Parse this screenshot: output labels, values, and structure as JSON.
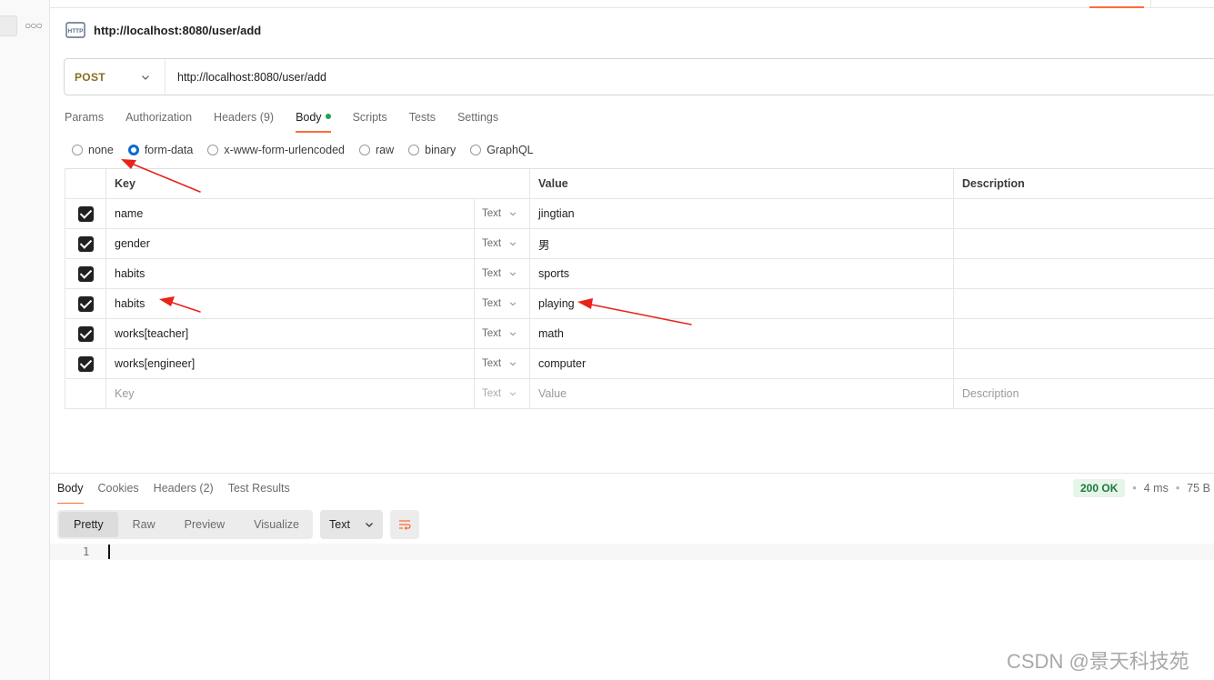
{
  "request": {
    "title": "http://localhost:8080/user/add",
    "method": "POST",
    "url": "http://localhost:8080/user/add"
  },
  "tabs": [
    {
      "label": "Params",
      "count": ""
    },
    {
      "label": "Authorization",
      "count": ""
    },
    {
      "label": "Headers",
      "count": "(9)"
    },
    {
      "label": "Body",
      "count": ""
    },
    {
      "label": "Scripts",
      "count": ""
    },
    {
      "label": "Tests",
      "count": ""
    },
    {
      "label": "Settings",
      "count": ""
    }
  ],
  "body_modes": [
    "none",
    "form-data",
    "x-www-form-urlencoded",
    "raw",
    "binary",
    "GraphQL"
  ],
  "selected_body_mode": "form-data",
  "table": {
    "headers": {
      "key": "Key",
      "value": "Value",
      "description": "Description"
    },
    "rows": [
      {
        "key": "name",
        "type": "Text",
        "value": "jingtian",
        "description": ""
      },
      {
        "key": "gender",
        "type": "Text",
        "value": "男",
        "description": ""
      },
      {
        "key": "habits",
        "type": "Text",
        "value": "sports",
        "description": ""
      },
      {
        "key": "habits",
        "type": "Text",
        "value": "playing",
        "description": ""
      },
      {
        "key": "works[teacher]",
        "type": "Text",
        "value": "math",
        "description": ""
      },
      {
        "key": "works[engineer]",
        "type": "Text",
        "value": "computer",
        "description": ""
      }
    ],
    "placeholder": {
      "key": "Key",
      "type": "Text",
      "value": "Value",
      "description": "Description"
    }
  },
  "response": {
    "tabs": [
      {
        "label": "Body",
        "count": ""
      },
      {
        "label": "Cookies",
        "count": ""
      },
      {
        "label": "Headers",
        "count": "(2)"
      },
      {
        "label": "Test Results",
        "count": ""
      }
    ],
    "status": "200 OK",
    "time": "4 ms",
    "size": "75 B",
    "views": [
      "Pretty",
      "Raw",
      "Preview",
      "Visualize"
    ],
    "format": "Text",
    "line_number": "1"
  },
  "watermark": "CSDN @景天科技苑",
  "colors": {
    "accent": "#ff6c37",
    "method": "#8a6d1f",
    "radio_selected": "#0b6bcb",
    "status_ok": "#1b7a3a",
    "annotation": "#e8231a"
  }
}
